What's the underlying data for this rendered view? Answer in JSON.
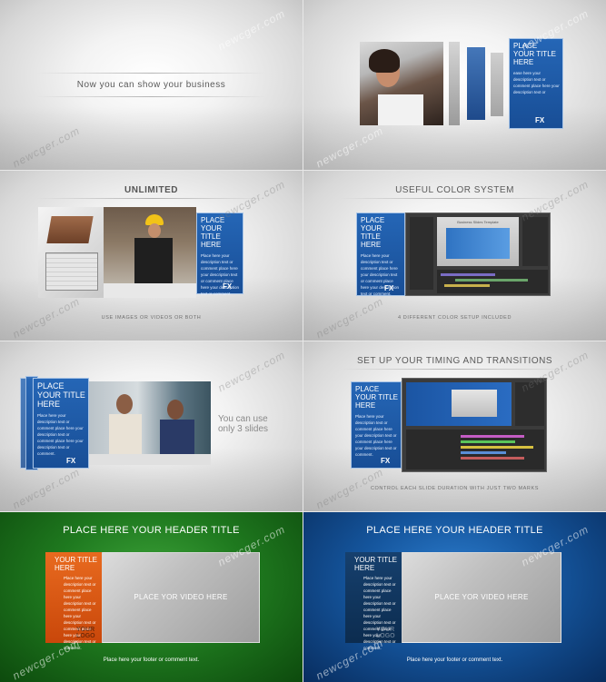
{
  "watermark": "newcger.com",
  "panels": {
    "intro": {
      "title": "Now you can show your business"
    },
    "phone": {
      "panel_title": "PLACE YOUR TITLE HERE",
      "panel_desc": "ease here your description text or comment place here your description text or",
      "logo": "FX"
    },
    "unlimited": {
      "heading": "UNLIMITED",
      "panel_title": "PLACE YOUR TITLE HERE",
      "panel_desc": "Place here your description text or comment place here your description text or comment place here your description text or comment.",
      "logo": "FX",
      "caption": "USE IMAGES OR VIDEOS OR BOTH"
    },
    "colors": {
      "heading": "USEFUL COLOR SYSTEM",
      "panel_title": "PLACE YOUR TITLE HERE",
      "panel_desc": "Place here your description text or comment place here your description text or comment place here your description text or comment.",
      "logo": "FX",
      "screen_label": "Business Slides Template",
      "caption": "4 DIFFERENT COLOR SETUP INCLUDED"
    },
    "slides": {
      "panel_title": "PLACE YOUR TITLE HERE",
      "panel_desc": "Place here your description text or comment place here your description text or comment place here your description text or comment.",
      "logo": "FX",
      "side_text": "You can use only 3 slides"
    },
    "timing": {
      "heading": "SET UP YOUR TIMING AND TRANSITIONS",
      "panel_title": "PLACE YOUR TITLE HERE",
      "panel_desc": "Place here your description text or comment place here your description text or comment place here your description text or comment.",
      "logo": "FX",
      "caption": "CONTROL EACH SLIDE DURATION WITH JUST TWO MARKS"
    },
    "green": {
      "header": "PLACE HERE YOUR HEADER TITLE",
      "panel_title": "YOUR TITLE HERE",
      "panel_desc": "Place here your description text or comment place here your description text or comment place here your description text or comment place here your description text or comment.",
      "logo": "YOUR LOGO",
      "video": "PLACE YOR VIDEO HERE",
      "footer": "Place here your footer or comment text.",
      "accent": "#e2580f"
    },
    "blue": {
      "header": "PLACE HERE YOUR HEADER TITLE",
      "panel_title": "YOUR TITLE HERE",
      "panel_desc": "Place here your description text or comment place here your description text or comment place here your description text or comment place here your description text or comment.",
      "logo": "YOUR LOGO",
      "video": "PLACE YOR VIDEO HERE",
      "footer": "Place here your footer or comment text.",
      "accent": "#0f3b66"
    }
  }
}
